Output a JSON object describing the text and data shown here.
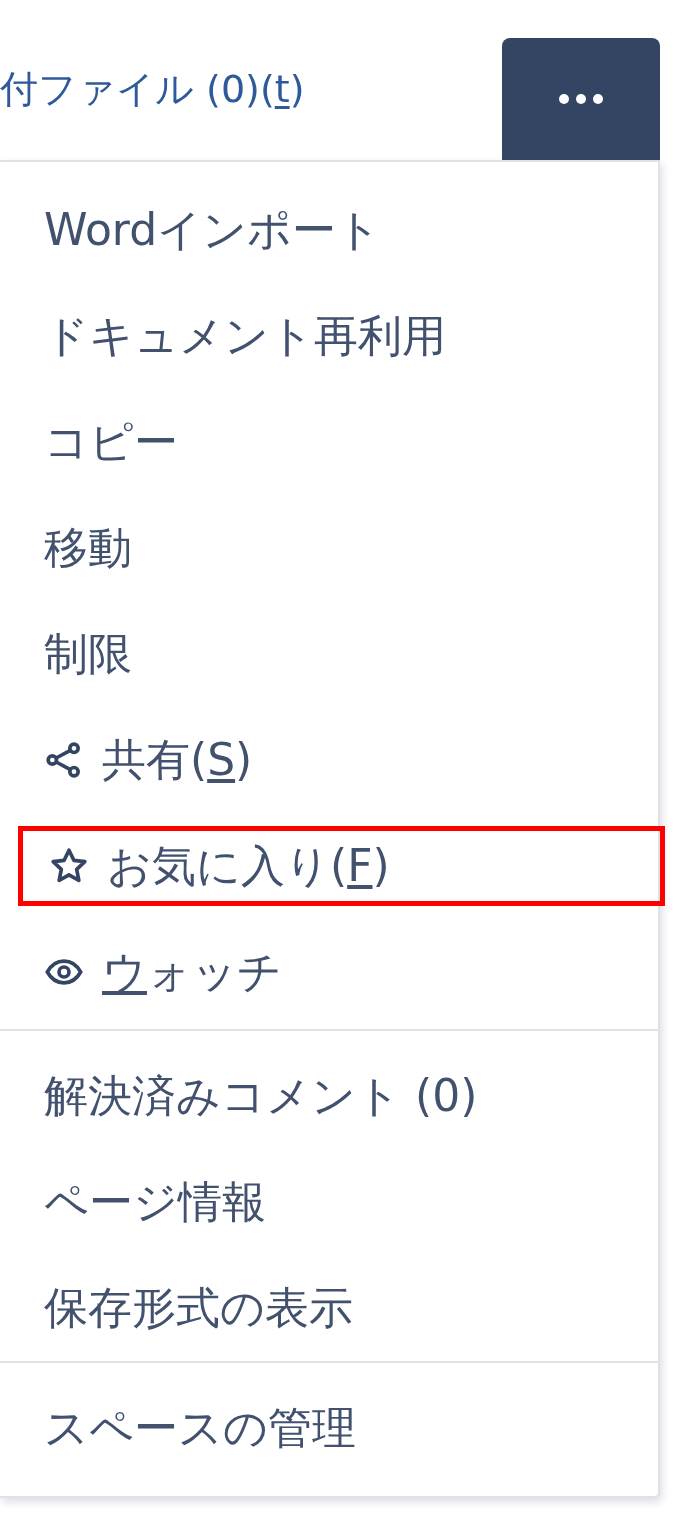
{
  "toolbar": {
    "attachments_link": [
      {
        "text": "付ファイル (0)("
      },
      {
        "text": "t",
        "underlined": true
      },
      {
        "text": ")"
      }
    ]
  },
  "menu": {
    "sections": [
      {
        "items": [
          {
            "kind": "text",
            "highlighted": false,
            "segments": [
              {
                "text": "Wordインポート"
              }
            ]
          },
          {
            "kind": "text",
            "highlighted": false,
            "segments": [
              {
                "text": "ドキュメント再利用"
              }
            ]
          },
          {
            "kind": "text",
            "highlighted": false,
            "segments": [
              {
                "text": "コピー"
              }
            ]
          },
          {
            "kind": "text",
            "highlighted": false,
            "segments": [
              {
                "text": "移動"
              }
            ]
          },
          {
            "kind": "text",
            "highlighted": false,
            "segments": [
              {
                "text": "制限"
              }
            ]
          },
          {
            "kind": "share",
            "highlighted": false,
            "segments": [
              {
                "text": "共有("
              },
              {
                "text": "S",
                "underlined": true
              },
              {
                "text": ")"
              }
            ]
          },
          {
            "kind": "star",
            "highlighted": true,
            "segments": [
              {
                "text": "お気に入り("
              },
              {
                "text": "F",
                "underlined": true
              },
              {
                "text": ")"
              }
            ]
          },
          {
            "kind": "eye",
            "highlighted": false,
            "segments": [
              {
                "text": "ウ",
                "underlined": true
              },
              {
                "text": "ォッチ"
              }
            ]
          }
        ]
      },
      {
        "items": [
          {
            "kind": "text",
            "highlighted": false,
            "segments": [
              {
                "text": "解決済みコメント (0)"
              }
            ]
          },
          {
            "kind": "text",
            "highlighted": false,
            "segments": [
              {
                "text": "ページ情報"
              }
            ]
          },
          {
            "kind": "text",
            "highlighted": false,
            "segments": [
              {
                "text": "保存形式の表示"
              }
            ]
          }
        ]
      },
      {
        "items": [
          {
            "kind": "text",
            "highlighted": false,
            "segments": [
              {
                "text": "スペースの管理"
              }
            ]
          }
        ]
      }
    ]
  }
}
